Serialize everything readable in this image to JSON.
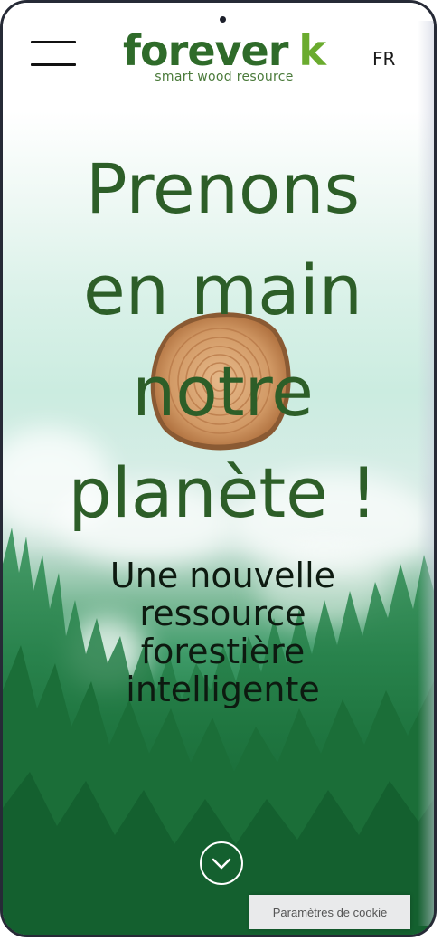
{
  "header": {
    "menu_icon": "hamburger-menu-icon",
    "logo": {
      "word_left": "forever",
      "word_right": "k",
      "tagline": "smart wood resource"
    },
    "language": "FR"
  },
  "hero": {
    "headline_lines": [
      "Prenons",
      "en main",
      "notre",
      "planète !"
    ],
    "subheadline_lines": [
      "Une nouvelle",
      "ressource",
      "forestière",
      "intelligente"
    ],
    "scroll_icon": "chevron-down-circle-icon",
    "image": "wood-slice"
  },
  "cookie_button": {
    "label": "Paramètres de cookie"
  },
  "colors": {
    "headline": "#2d5e28",
    "logo_dark": "#2f6b2a",
    "logo_accent": "#6aab2e",
    "forest": "#1f7d43"
  }
}
